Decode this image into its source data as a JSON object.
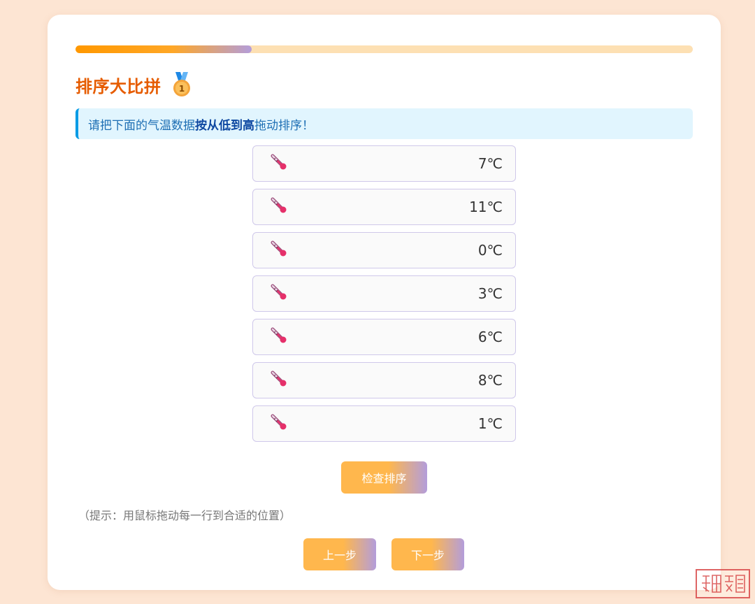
{
  "progress": {
    "fraction": 0.285
  },
  "header": {
    "title": "排序大比拼",
    "icon": "medal-icon"
  },
  "instruction": {
    "prefix": "请把下面的气温数据 ",
    "emphasis": "按从低到高",
    "suffix": "拖动排序！"
  },
  "items": [
    {
      "icon": "thermometer-icon",
      "value": "7℃"
    },
    {
      "icon": "thermometer-icon",
      "value": "11℃"
    },
    {
      "icon": "thermometer-icon",
      "value": "0℃"
    },
    {
      "icon": "thermometer-icon",
      "value": "3℃"
    },
    {
      "icon": "thermometer-icon",
      "value": "6℃"
    },
    {
      "icon": "thermometer-icon",
      "value": "8℃"
    },
    {
      "icon": "thermometer-icon",
      "value": "1℃"
    }
  ],
  "buttons": {
    "check": "检查排序",
    "prev": "上一步",
    "next": "下一步"
  },
  "hint": "（提示：用鼠标拖动每一行到合适的位置）",
  "colors": {
    "accent": "#ff9800",
    "title": "#e65c00",
    "info_border": "#039be5",
    "info_bg": "#e1f5fe",
    "button_start": "#ffb74d",
    "button_end": "#b39ddb"
  }
}
